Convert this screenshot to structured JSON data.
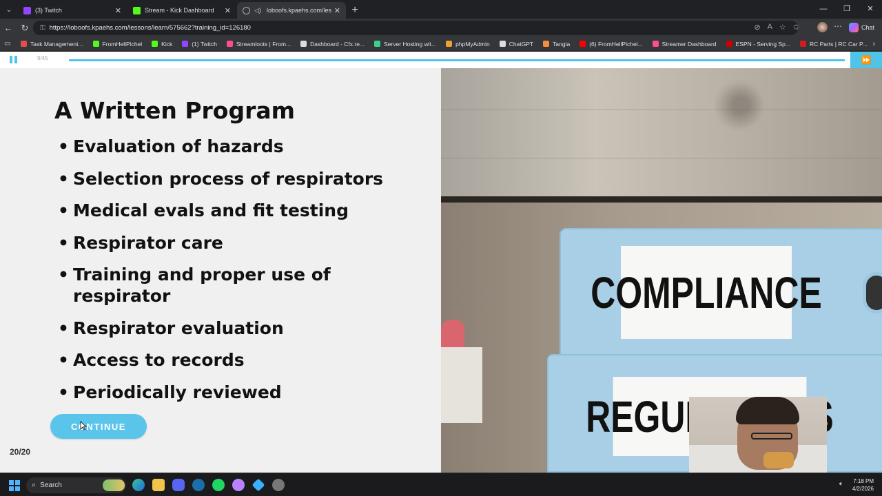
{
  "browser": {
    "tabs": [
      {
        "label": "(3) Twitch",
        "color": "#9146ff"
      },
      {
        "label": "Stream - Kick Dashboard",
        "color": "#53fc18"
      },
      {
        "label": "loboofs.kpaehs.com/lessons/l",
        "color": "#888888"
      }
    ],
    "url": "https://loboofs.kpaehs.com/lessons/learn/575662?training_id=126180",
    "chat_label": "Chat",
    "bookmarks": [
      {
        "label": "Task Management...",
        "color": "#e04f4f"
      },
      {
        "label": "FromHellPichel",
        "color": "#53fc18"
      },
      {
        "label": "Kick",
        "color": "#53fc18"
      },
      {
        "label": "(1) Twitch",
        "color": "#9146ff"
      },
      {
        "label": "Streamloots | From...",
        "color": "#ff4d8d"
      },
      {
        "label": "Dashboard - Cfx.re...",
        "color": "#dddddd"
      },
      {
        "label": "Server Hosting wit...",
        "color": "#3ecf8e"
      },
      {
        "label": "phpMyAdmin",
        "color": "#f0a030"
      },
      {
        "label": "ChatGPT",
        "color": "#dddddd"
      },
      {
        "label": "Tangia",
        "color": "#ff8a3d"
      },
      {
        "label": "(6) FromHellPichel...",
        "color": "#ff0000"
      },
      {
        "label": "Streamer Dashboard",
        "color": "#ff4d8d"
      },
      {
        "label": "ESPN - Serving Sp...",
        "color": "#cc0000"
      },
      {
        "label": "RC Parts | RC Car P...",
        "color": "#d01c1c"
      }
    ]
  },
  "player": {
    "slide_counter": "9/45",
    "progress": 1.0,
    "accent": "#4fc3e8"
  },
  "slide": {
    "title": "A Written Program",
    "bullets": [
      "Evaluation of hazards",
      "Selection process of respirators",
      "Medical evals and fit testing",
      "Respirator care",
      "Training and proper use of respirator",
      "Respirator evaluation",
      "Access to records",
      "Periodically reviewed"
    ],
    "continue_label": "CONTINUE",
    "logo": "20/20",
    "photo_labels": {
      "top": "COMPLIANCE",
      "bottom": "REGULATIONS"
    }
  },
  "taskbar": {
    "search_label": "Search",
    "time": "7:18 PM",
    "date": "4/2/2026"
  }
}
